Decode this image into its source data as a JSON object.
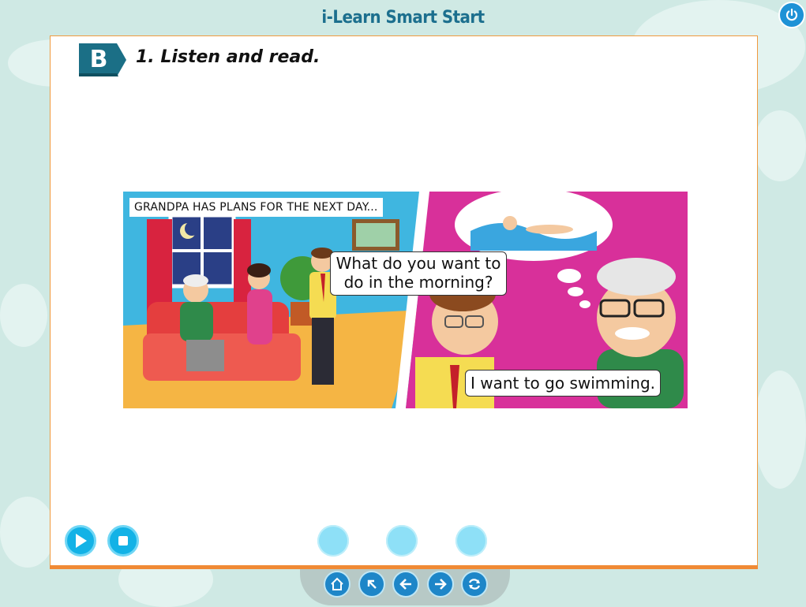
{
  "app": {
    "title": "i-Learn Smart Start"
  },
  "section": {
    "badge": "B",
    "instruction": "1. Listen and read."
  },
  "comic": {
    "caption": "GRANDPA HAS PLANS FOR THE NEXT DAY...",
    "bubble_question": "What do you want to do in the morning?",
    "bubble_answer": "I want to go swimming."
  },
  "controls": {
    "play_icon": "play-icon",
    "stop_icon": "stop-icon",
    "dots": 3
  },
  "nav": {
    "buttons": [
      "home-icon",
      "arrow-up-left-icon",
      "arrow-left-icon",
      "arrow-right-icon",
      "refresh-icon"
    ]
  },
  "colors": {
    "background": "#cfe9e4",
    "title": "#1c6f8e",
    "panel_border": "#f09a3e",
    "accent_blue": "#13b2e6",
    "nav_blue": "#1e86c8",
    "badge": "#1b6f86"
  }
}
